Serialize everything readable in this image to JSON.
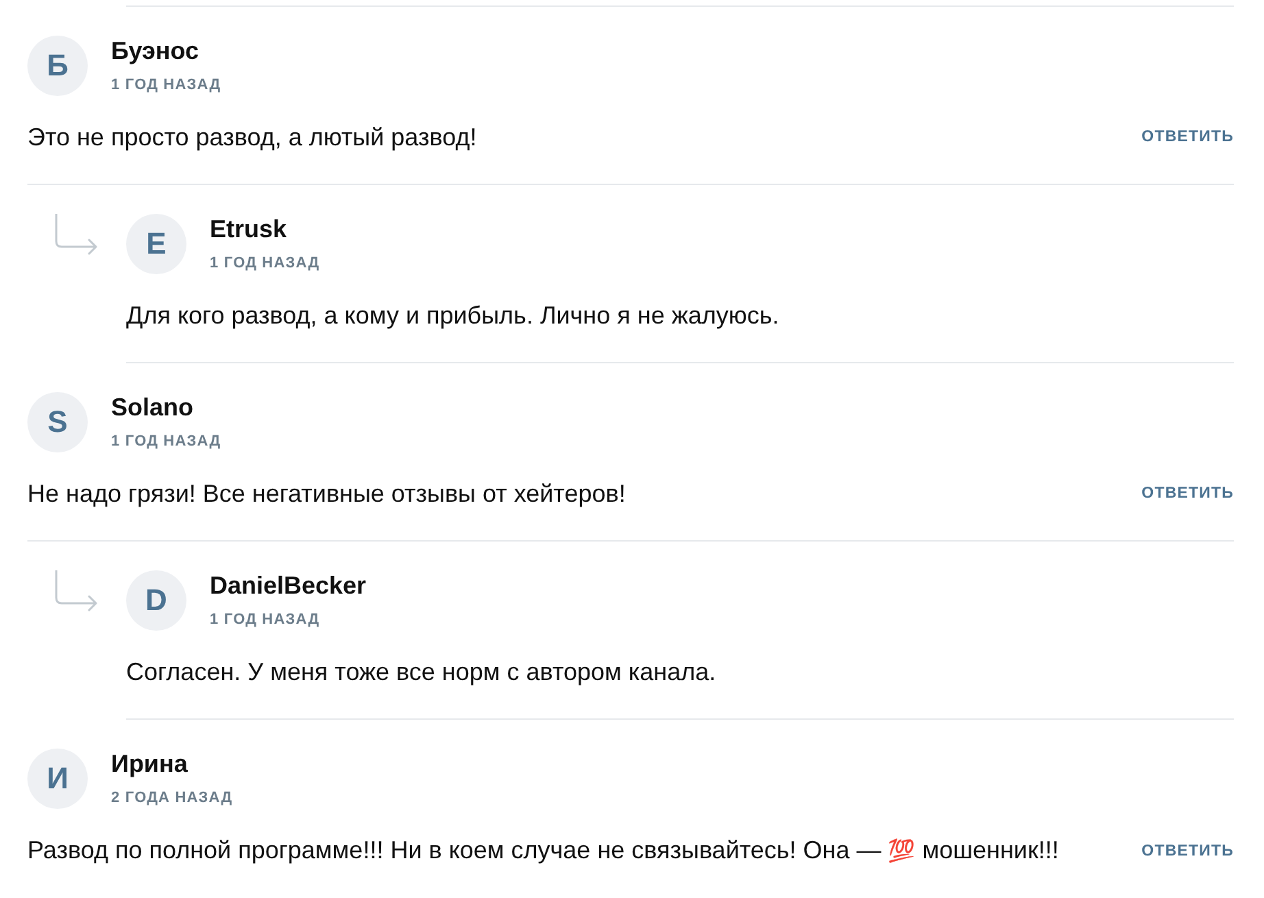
{
  "comments": [
    {
      "author": "Буэнос",
      "initial": "Б",
      "time": "1 ГОД НАЗАД",
      "body": [
        {
          "kind": "text",
          "value": "Это не просто развод, а лютый развод!"
        }
      ],
      "reply": "ОТВЕТИТЬ",
      "children": [
        {
          "author": "Etrusk",
          "initial": "E",
          "time": "1 ГОД НАЗАД",
          "body": [
            {
              "kind": "text",
              "value": "Для кого развод, а кому и прибыль. Лично я не жалуюсь."
            }
          ]
        }
      ]
    },
    {
      "author": "Solano",
      "initial": "S",
      "time": "1 ГОД НАЗАД",
      "body": [
        {
          "kind": "text",
          "value": "Не надо грязи! Все негативные отзывы от хейтеров!"
        }
      ],
      "reply": "ОТВЕТИТЬ",
      "children": [
        {
          "author": "DanielBecker",
          "initial": "D",
          "time": "1 ГОД НАЗАД",
          "body": [
            {
              "kind": "text",
              "value": "Согласен. У меня тоже все норм с автором канала."
            }
          ]
        }
      ]
    },
    {
      "author": "Ирина",
      "initial": "И",
      "time": "2 ГОДА НАЗАД",
      "body": [
        {
          "kind": "text",
          "value": "Развод по полной программе!!! Ни в коем случае не связывайтесь! Она —"
        },
        {
          "kind": "emoji",
          "value": "💯"
        },
        {
          "kind": "text",
          "value": "мошенник!!!"
        }
      ],
      "reply": "ОТВЕТИТЬ"
    }
  ]
}
